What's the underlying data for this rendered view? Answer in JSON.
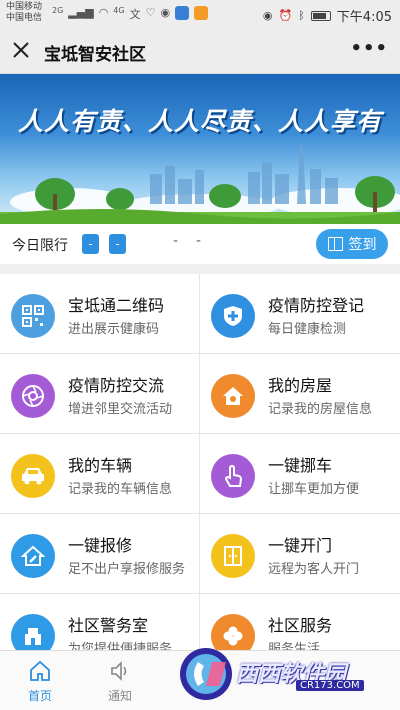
{
  "status_bar": {
    "carrier_1": "中国移动",
    "carrier_2": "中国电信",
    "network": "2G",
    "network_2": "4G",
    "time": "下午4:05"
  },
  "nav": {
    "title": "宝坻智安社区"
  },
  "banner": {
    "slogan": "人人有责、人人尽责、人人享有"
  },
  "limit": {
    "label": "今日限行",
    "badge_1": "-",
    "badge_2": "-",
    "dash_1": "-",
    "dash_2": "-",
    "checkin_label": "签到"
  },
  "services": [
    {
      "title": "宝坻通二维码",
      "subtitle": "进出展示健康码",
      "icon": "qr-code-icon",
      "color": "#4da0e0"
    },
    {
      "title": "疫情防控登记",
      "subtitle": "每日健康检测",
      "icon": "shield-plus-icon",
      "color": "#2f8fe0"
    },
    {
      "title": "疫情防控交流",
      "subtitle": "增进邻里交流活动",
      "icon": "camera-aperture-icon",
      "color": "#a45bd6"
    },
    {
      "title": "我的房屋",
      "subtitle": "记录我的房屋信息",
      "icon": "house-icon",
      "color": "#f08a2c"
    },
    {
      "title": "我的车辆",
      "subtitle": "记录我的车辆信息",
      "icon": "car-icon",
      "color": "#f4c21c"
    },
    {
      "title": "一键挪车",
      "subtitle": "让挪车更加方便",
      "icon": "tap-hand-icon",
      "color": "#a45bd6"
    },
    {
      "title": "一键报修",
      "subtitle": "足不出户享报修服务",
      "icon": "repair-house-icon",
      "color": "#2f9be6"
    },
    {
      "title": "一键开门",
      "subtitle": "远程为客人开门",
      "icon": "door-icon",
      "color": "#f4c21c"
    },
    {
      "title": "社区警务室",
      "subtitle": "为您提供便捷服务",
      "icon": "police-station-icon",
      "color": "#2f9be6"
    },
    {
      "title": "社区服务",
      "subtitle": "服务生活",
      "icon": "clover-icon",
      "color": "#f08a2c"
    }
  ],
  "tabs": [
    {
      "label": "首页",
      "icon": "home-icon",
      "active": true
    },
    {
      "label": "通知",
      "icon": "speaker-icon",
      "active": false
    }
  ],
  "watermark": {
    "text": "西西软件园",
    "url": "CR173.COM"
  },
  "colors": {
    "accent": "#2c8fdf",
    "checkin": "#38a0ea",
    "tab_active": "#2c8fdf",
    "tab_inactive": "#888888"
  }
}
